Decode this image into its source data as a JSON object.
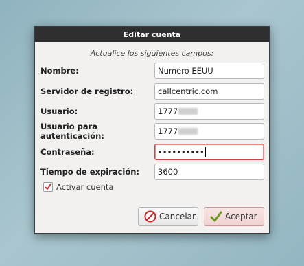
{
  "dialog": {
    "title": "Editar cuenta",
    "subtitle": "Actualice los siguientes campos:"
  },
  "fields": [
    {
      "label": "Nombre:",
      "value": "Numero EEUU"
    },
    {
      "label": "Servidor de registro:",
      "value": "callcentric.com"
    },
    {
      "label": "Usuario:",
      "value": "1777"
    },
    {
      "label": "Usuario para autenticación:",
      "value": "1777"
    },
    {
      "label": "Contraseña:",
      "value": "••••••••••"
    },
    {
      "label": "Tiempo de expiración:",
      "value": "3600"
    }
  ],
  "checkbox": {
    "label": "Activar cuenta",
    "checked": true
  },
  "buttons": {
    "cancel": "Cancelar",
    "accept": "Aceptar"
  },
  "icons": {
    "cancel": "cancel-icon",
    "accept": "check-icon"
  },
  "colors": {
    "titlebar": "#2f2f2f",
    "focus": "#cc4444",
    "accept_check": "#6a9a1f",
    "cancel_icon": "#c62828"
  }
}
